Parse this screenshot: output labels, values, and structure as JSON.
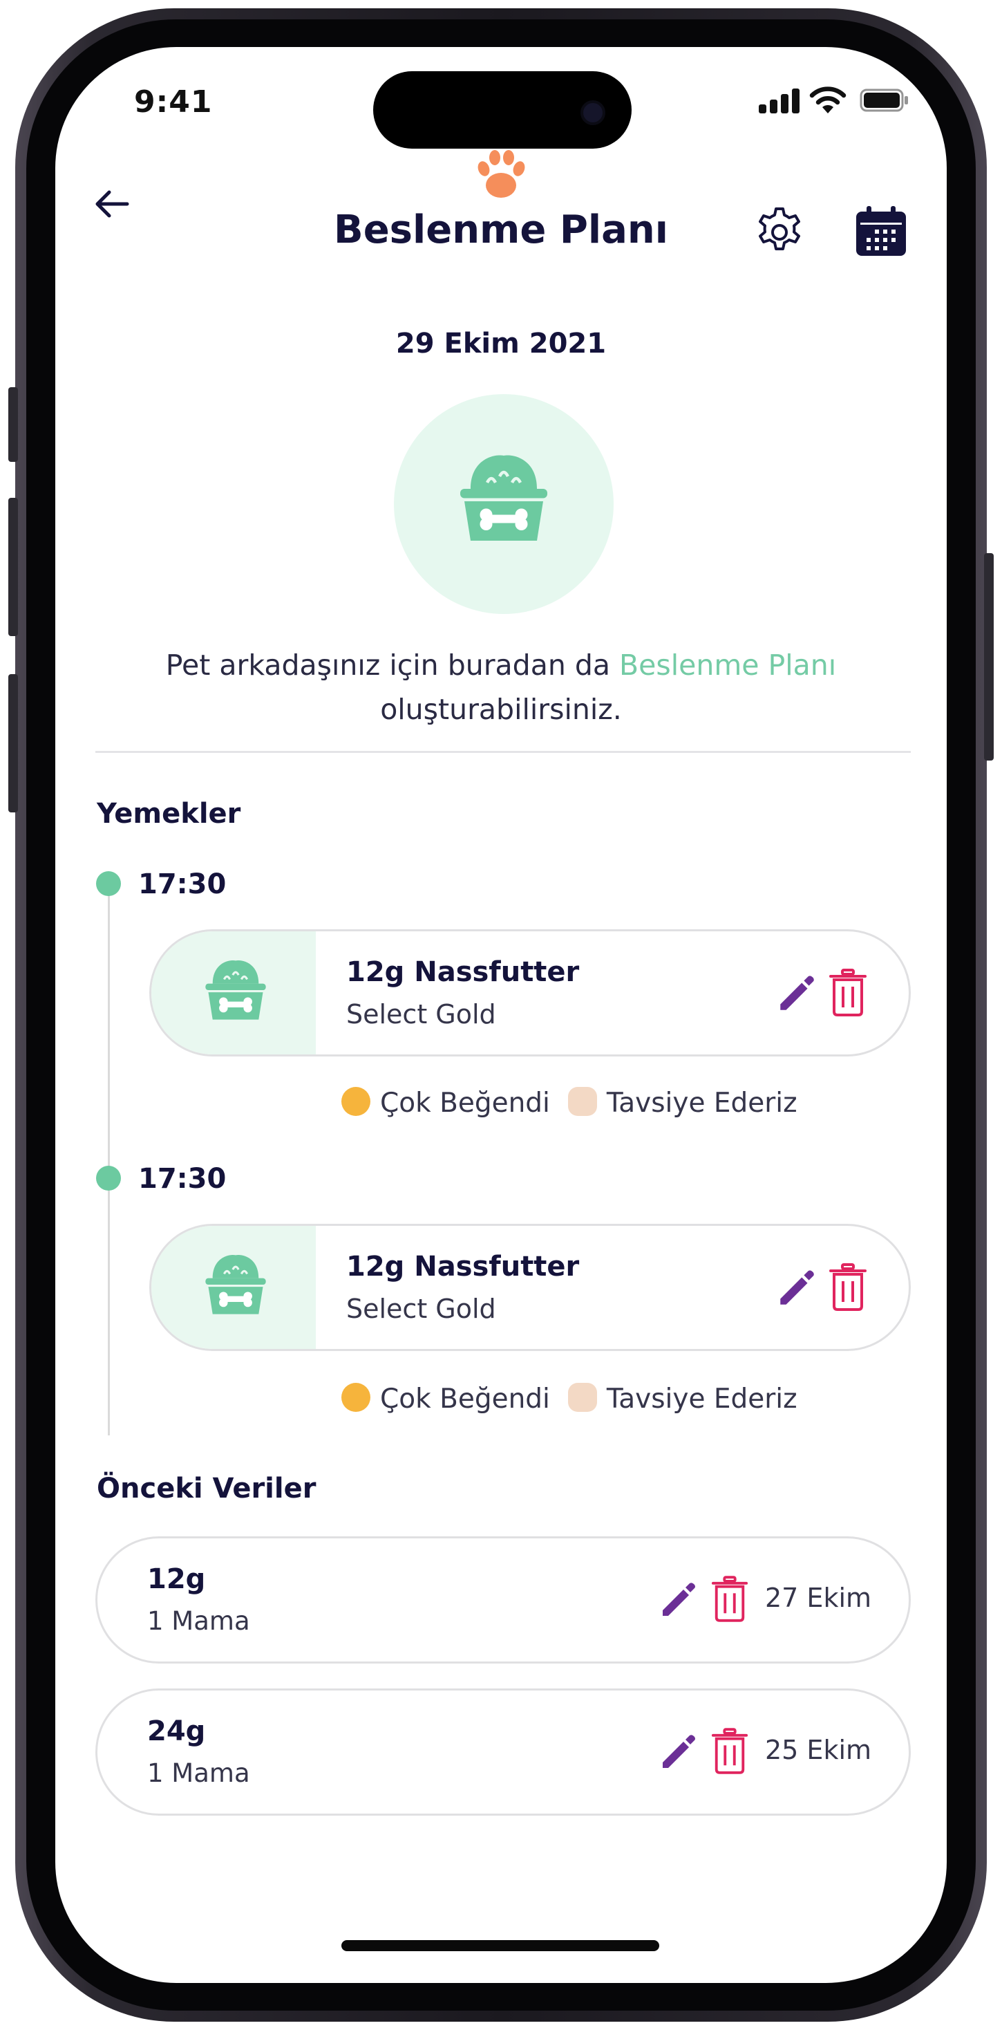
{
  "status_bar": {
    "time": "9:41"
  },
  "header": {
    "title": "Beslenme Planı",
    "back_icon": "arrow-left-icon",
    "settings_icon": "gear-icon",
    "calendar_icon": "calendar-icon",
    "logo_icon": "paw-icon"
  },
  "date": "29 Ekim 2021",
  "hero_icon": "food-bowl-icon",
  "description": {
    "before": "Pet arkadaşınız için buradan da ",
    "highlight": "Beslenme Planı",
    "after": " oluşturabilirsiniz."
  },
  "colors": {
    "primary_dark": "#14133b",
    "accent_green": "#74cba5",
    "edit_purple": "#6b2f96",
    "delete_red": "#e0245e",
    "card_tint": "#e9f8f0"
  },
  "meals_section": {
    "title": "Yemekler",
    "items": [
      {
        "time": "17:30",
        "title": "12g Nassfutter",
        "subtitle": "Select Gold",
        "reaction_1": "Çok Beğendi",
        "reaction_2": "Tavsiye Ederiz"
      },
      {
        "time": "17:30",
        "title": "12g Nassfutter",
        "subtitle": "Select Gold",
        "reaction_1": "Çok Beğendi",
        "reaction_2": "Tavsiye Ederiz"
      }
    ]
  },
  "previous_section": {
    "title": "Önceki Veriler",
    "items": [
      {
        "amount": "12g",
        "subtitle": "1 Mama",
        "date": "27 Ekim"
      },
      {
        "amount": "24g",
        "subtitle": "1 Mama",
        "date": "25 Ekim"
      }
    ]
  }
}
